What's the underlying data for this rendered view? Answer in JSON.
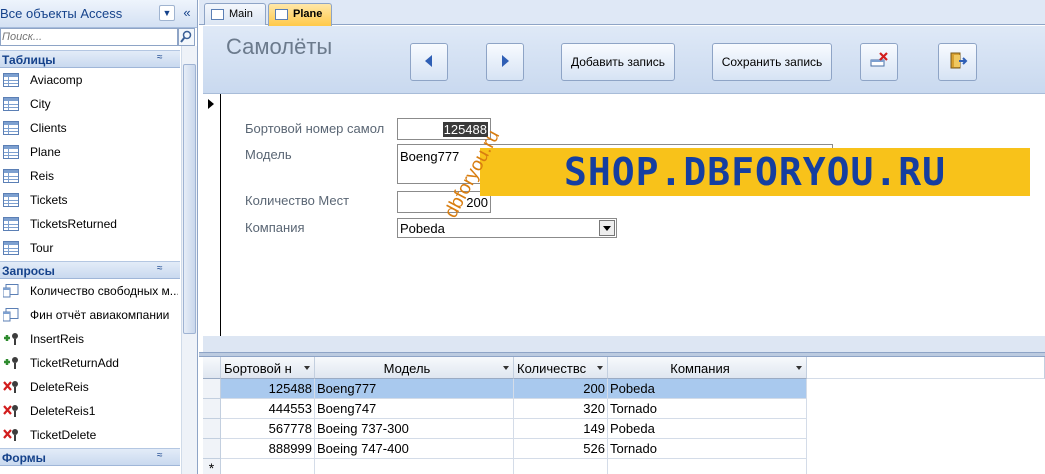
{
  "nav": {
    "title": "Все объекты Access",
    "search_placeholder": "Поиск...",
    "groups": [
      {
        "label": "Таблицы",
        "items": [
          "Aviacomp",
          "City",
          "Clients",
          "Plane",
          "Reis",
          "Tickets",
          "TicketsReturned",
          "Tour"
        ]
      },
      {
        "label": "Запросы",
        "items": [
          "Количество свободных м...",
          "Фин отчёт авиакомпании",
          "InsertReis",
          "TicketReturnAdd",
          "DeleteReis",
          "DeleteReis1",
          "TicketDelete"
        ]
      },
      {
        "label": "Формы",
        "items": []
      }
    ]
  },
  "tabs": [
    {
      "label": "Main",
      "active": false
    },
    {
      "label": "Plane",
      "active": true
    }
  ],
  "form": {
    "title": "Самолёты",
    "buttons": {
      "prev": "previous-record",
      "next": "next-record",
      "add": "Добавить запись",
      "save": "Сохранить запись",
      "delete": "delete-record",
      "close": "close-form"
    },
    "fields": {
      "number_label": "Бортовой номер самол",
      "number_value": "125488",
      "model_label": "Модель",
      "model_value": "Boeng777",
      "seats_label": "Количество Мест",
      "seats_value": "200",
      "company_label": "Компания",
      "company_value": "Pobeda"
    }
  },
  "datasheet": {
    "columns": [
      "Бортовой н",
      "Модель",
      "Количествс",
      "Компания"
    ],
    "rows": [
      [
        "125488",
        "Boeng777",
        "200",
        "Pobeda"
      ],
      [
        "444553",
        "Boeng747",
        "320",
        "Tornado"
      ],
      [
        "567778",
        "Boeing 737-300",
        "149",
        "Pobeda"
      ],
      [
        "888999",
        "Boeing 747-400",
        "526",
        "Tornado"
      ]
    ],
    "selected_row": 0,
    "new_row_marker": "*"
  },
  "watermarks": {
    "banner": "SHOP.DBFORYOU.RU",
    "diagonal": "dbforyou.ru"
  },
  "colors": {
    "accent": "#15428b",
    "tab_active": "#ffc94a",
    "selection": "#a9c9ee",
    "banner_bg": "#f8c21a",
    "banner_text": "#153ea0"
  }
}
